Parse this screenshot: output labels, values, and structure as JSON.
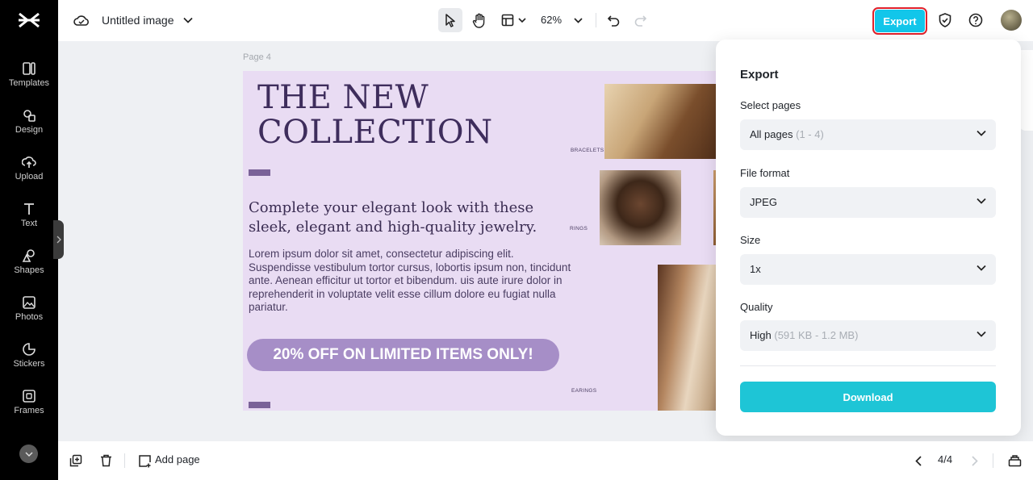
{
  "rail": {
    "items": [
      {
        "label": "Templates",
        "icon": "templates-icon"
      },
      {
        "label": "Design",
        "icon": "design-icon"
      },
      {
        "label": "Upload",
        "icon": "upload-icon"
      },
      {
        "label": "Text",
        "icon": "text-icon"
      },
      {
        "label": "Shapes",
        "icon": "shapes-icon"
      },
      {
        "label": "Photos",
        "icon": "photos-icon"
      },
      {
        "label": "Stickers",
        "icon": "stickers-icon"
      },
      {
        "label": "Frames",
        "icon": "frames-icon"
      }
    ]
  },
  "topbar": {
    "title": "Untitled image",
    "zoom": "62%",
    "export_label": "Export",
    "accent": "#12c6ea"
  },
  "canvas": {
    "page_label": "Page 4",
    "headline_line1": "THE NEW",
    "headline_line2": "COLLECTION",
    "subhead": "Complete your elegant look with these sleek, elegant and high-quality jewelry.",
    "body": "Lorem ipsum dolor sit amet, consectetur adipiscing elit. Suspendisse vestibulum tortor cursus, lobortis ipsum non, tincidunt ante. Aenean efficitur ut tortor et bibendum. uis aute irure dolor in reprehenderit in voluptate velit esse cillum dolore eu fugiat nulla pariatur.",
    "promo": "20% OFF ON LIMITED ITEMS ONLY!",
    "tags": {
      "bracelets": "BRACELETS",
      "rings": "RINGS",
      "earings": "EARINGS"
    },
    "background": "#e9dcf3"
  },
  "export_panel": {
    "title": "Export",
    "select_pages_label": "Select pages",
    "select_pages_value": "All pages",
    "select_pages_hint": "(1 - 4)",
    "file_format_label": "File format",
    "file_format_value": "JPEG",
    "size_label": "Size",
    "size_value": "1x",
    "quality_label": "Quality",
    "quality_value": "High",
    "quality_hint": "(591 KB - 1.2 MB)",
    "download_label": "Download",
    "download_color": "#1ec5d6"
  },
  "bottombar": {
    "add_page_label": "Add page",
    "page_count": "4/4"
  }
}
